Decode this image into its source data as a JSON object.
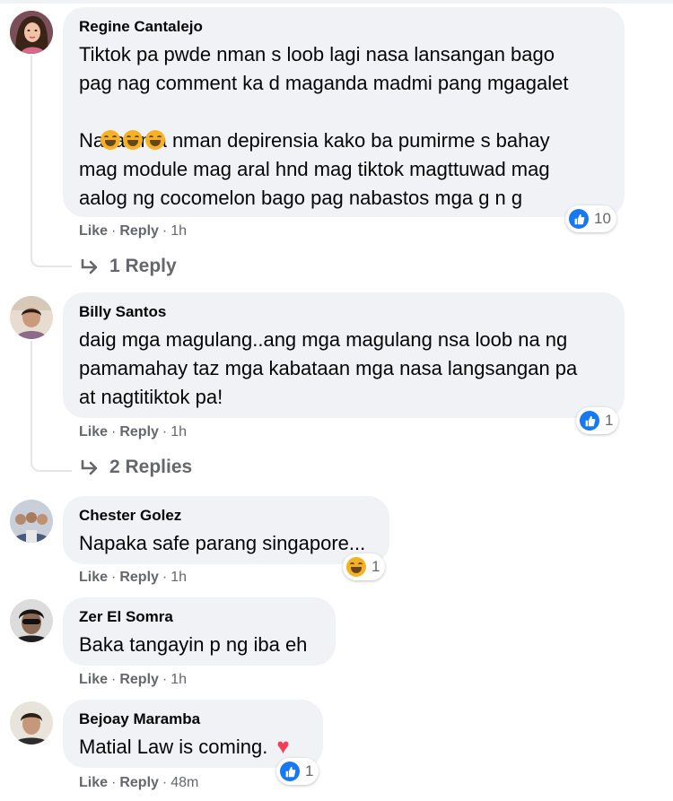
{
  "comments": [
    {
      "author": "Regine Cantalejo",
      "text_lines": [
        "Tiktok pa pwde nman s loob lagi nasa lansangan bago",
        "pag nag comment ka d maganda madmi pang mgagalet",
        "Nasa knla nman depirensia kako ba pumirme s bahay",
        "mag module mag aral hnd mag tiktok magttuwad mag",
        "aalog ng cocomelon bago pag nabastos mga g n g"
      ],
      "emoji_row": [
        "rofl-emoji",
        "rofl-emoji",
        "rofl-emoji"
      ],
      "like": "Like",
      "reply": "Reply",
      "time": "1h",
      "reaction_count": "10",
      "replies_label": "1 Reply"
    },
    {
      "author": "Billy Santos",
      "text_lines": [
        "daig mga magulang..ang mga magulang nsa loob na ng",
        "pamamahay taz mga kabataan mga nasa langsangan pa",
        "at nagtitiktok pa!"
      ],
      "like": "Like",
      "reply": "Reply",
      "time": "1h",
      "reaction_count": "1",
      "replies_label": "2 Replies"
    },
    {
      "author": "Chester Golez",
      "text_lines": [
        "Napaka safe parang singapore..."
      ],
      "like": "Like",
      "reply": "Reply",
      "time": "1h",
      "reaction_count": "1"
    },
    {
      "author": "Zer El Somra",
      "text_lines": [
        "Baka tangayin p ng iba eh"
      ],
      "like": "Like",
      "reply": "Reply",
      "time": "1h"
    },
    {
      "author": "Bejoay Maramba",
      "text_lines": [
        "Matial Law is coming. "
      ],
      "like": "Like",
      "reply": "Reply",
      "time": "48m",
      "reaction_count": "1"
    }
  ],
  "colors": {
    "bubble": "#f0f2f5",
    "meta_text": "#65676b",
    "like_blue": "#1877f2",
    "heart_red": "#f33e58",
    "emoji_yellow": "#f7b125"
  },
  "icons": [
    "like-reaction-icon",
    "haha-reaction-icon",
    "rofl-emoji",
    "red-heart-emoji",
    "reply-arrow-icon"
  ]
}
